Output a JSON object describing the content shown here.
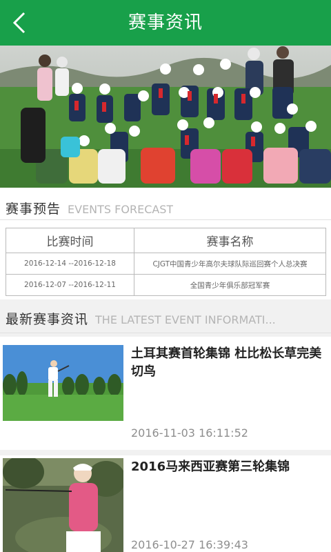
{
  "header": {
    "title": "赛事资讯",
    "back_icon": "chevron-left-icon"
  },
  "forecast": {
    "title_cn": "赛事预告",
    "title_en": "EVENTS FORECAST",
    "columns": [
      "比赛时间",
      "赛事名称"
    ],
    "rows": [
      {
        "date": "2016-12-14 --2016-12-18",
        "name": "CJGT中国青少年高尔夫球队际巡回赛个人总决赛"
      },
      {
        "date": "2016-12-07 --2016-12-11",
        "name": "全国青少年俱乐部冠军赛"
      }
    ]
  },
  "news": {
    "title_cn": "最新赛事资讯",
    "title_en": "THE LATEST EVENT INFORMATI...",
    "items": [
      {
        "title": "土耳其赛首轮集锦 杜比松长草完美切鸟",
        "date": "2016-11-03 16:11:52"
      },
      {
        "title": "2016马来西亚赛第三轮集锦",
        "date": "2016-10-27 16:39:43"
      }
    ]
  },
  "colors": {
    "brand": "#18a04a"
  }
}
